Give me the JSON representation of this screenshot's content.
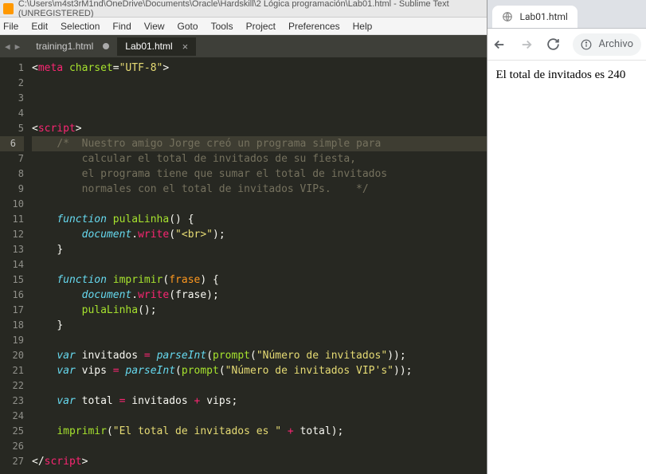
{
  "titlebar": "C:\\Users\\m4st3rM1nd\\OneDrive\\Documents\\Oracle\\Hardskill\\2 Lógica programación\\Lab01.html - Sublime Text (UNREGISTERED)",
  "menu": [
    "File",
    "Edit",
    "Selection",
    "Find",
    "View",
    "Goto",
    "Tools",
    "Project",
    "Preferences",
    "Help"
  ],
  "tabs": [
    {
      "label": "training1.html",
      "modified": true,
      "active": false
    },
    {
      "label": "Lab01.html",
      "modified": false,
      "active": true
    }
  ],
  "lines": [
    {
      "n": 1,
      "html": "<span class='white'>&lt;</span><span class='red'>meta</span> <span class='green'>charset</span><span class='white'>=</span><span class='str'>\"UTF-8\"</span><span class='white'>&gt;</span>"
    },
    {
      "n": 2,
      "html": " "
    },
    {
      "n": 3,
      "html": " "
    },
    {
      "n": 4,
      "html": " "
    },
    {
      "n": 5,
      "html": "<span class='white'>&lt;</span><span class='red'>script</span><span class='white'>&gt;</span>"
    },
    {
      "n": 6,
      "hl": true,
      "html": "    <span class='gray'>/*  Nuestro amigo Jorge creó un programa simple para</span>"
    },
    {
      "n": 7,
      "html": "        <span class='gray'>calcular el total de invitados de su fiesta,</span>"
    },
    {
      "n": 8,
      "html": "        <span class='gray'>el programa tiene que sumar el total de invitados</span>"
    },
    {
      "n": 9,
      "html": "        <span class='gray'>normales con el total de invitados VIPs.    */</span>"
    },
    {
      "n": 10,
      "html": " "
    },
    {
      "n": 11,
      "html": "    <span class='var'>function</span> <span class='fn'>pulaLinha</span><span class='white'>() {</span>"
    },
    {
      "n": 12,
      "html": "        <span class='blue'>document</span><span class='white'>.</span><span class='red'>write</span><span class='white'>(</span><span class='str'>\"&lt;br&gt;\"</span><span class='white'>);</span>"
    },
    {
      "n": 13,
      "html": "    <span class='white'>}</span>"
    },
    {
      "n": 14,
      "html": " "
    },
    {
      "n": 15,
      "html": "    <span class='var'>function</span> <span class='fn'>imprimir</span><span class='white'>(</span><span class='orange'>frase</span><span class='white'>) {</span>"
    },
    {
      "n": 16,
      "html": "        <span class='blue'>document</span><span class='white'>.</span><span class='red'>write</span><span class='white'>(frase);</span>"
    },
    {
      "n": 17,
      "html": "        <span class='fn'>pulaLinha</span><span class='white'>();</span>"
    },
    {
      "n": 18,
      "html": "    <span class='white'>}</span>"
    },
    {
      "n": 19,
      "html": " "
    },
    {
      "n": 20,
      "html": "    <span class='var'>var</span> <span class='white'>invitados </span><span class='red'>=</span> <span class='blue'>parseInt</span><span class='white'>(</span><span class='fn'>prompt</span><span class='white'>(</span><span class='str'>\"Número de invitados\"</span><span class='white'>));</span>"
    },
    {
      "n": 21,
      "html": "    <span class='var'>var</span> <span class='white'>vips </span><span class='red'>=</span> <span class='blue'>parseInt</span><span class='white'>(</span><span class='fn'>prompt</span><span class='white'>(</span><span class='str'>\"Número de invitados VIP's\"</span><span class='white'>));</span>"
    },
    {
      "n": 22,
      "html": " "
    },
    {
      "n": 23,
      "html": "    <span class='var'>var</span> <span class='white'>total </span><span class='red'>=</span> <span class='white'>invitados </span><span class='red'>+</span> <span class='white'>vips;</span>"
    },
    {
      "n": 24,
      "html": " "
    },
    {
      "n": 25,
      "html": "    <span class='fn'>imprimir</span><span class='white'>(</span><span class='str'>\"El total de invitados es \"</span> <span class='red'>+</span> <span class='white'>total);</span>"
    },
    {
      "n": 26,
      "html": " "
    },
    {
      "n": 27,
      "html": "<span class='white'>&lt;/</span><span class='red'>script</span><span class='white'>&gt;</span>"
    }
  ],
  "browser": {
    "tab_title": "Lab01.html",
    "url_text": "Archivo",
    "content": "El total de invitados es 240"
  }
}
